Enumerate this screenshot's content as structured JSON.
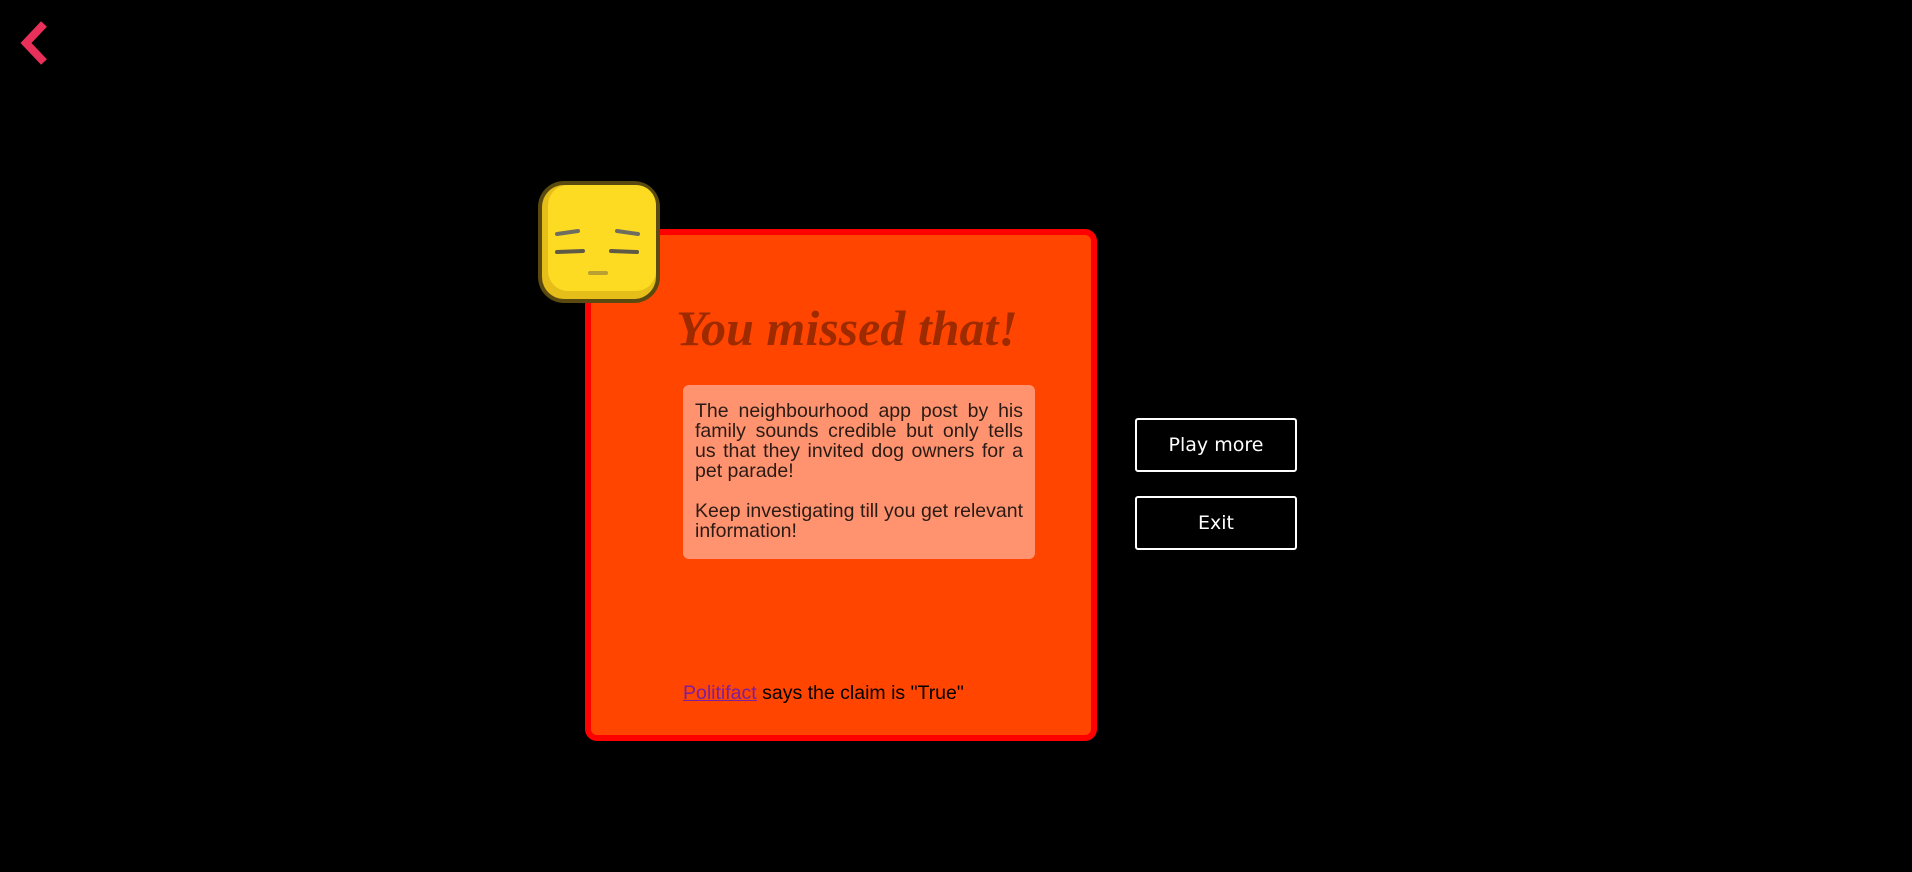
{
  "navigation": {
    "back_icon": "chevron-left-icon",
    "accent_color": "#e8305a"
  },
  "result_card": {
    "title": "You missed that!",
    "background_color": "#ff4500",
    "border_color": "#ff0000",
    "face_icon": "expressionless-face-icon",
    "message_paragraphs": [
      "The neighbourhood app post by his family sounds credible but only tells us that they invited dog owners for a pet parade!",
      "Keep investigating till you get relevant information!"
    ],
    "verdict": {
      "source_link": "Politifact",
      "text": " says the claim is \"True\""
    }
  },
  "actions": {
    "play_more": "Play more",
    "exit": "Exit"
  }
}
